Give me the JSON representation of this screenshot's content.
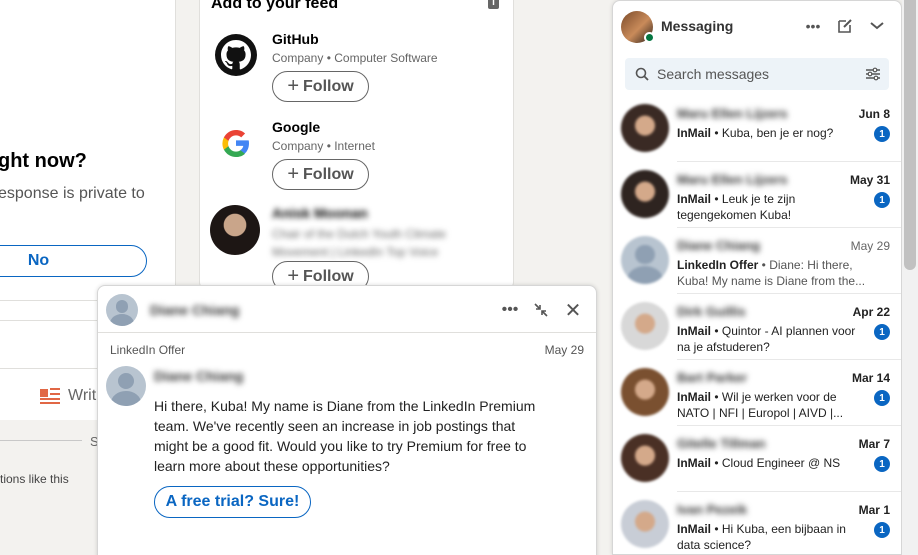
{
  "left": {
    "question": "ght now?",
    "sub": "esponse is private to",
    "no_button": "No",
    "write_label": "Writ",
    "s_label": "S",
    "options_text": "tions like this"
  },
  "feed": {
    "title": "Add to your feed",
    "items": [
      {
        "name": "GitHub",
        "meta": "Company • Computer Software",
        "follow": "Follow"
      },
      {
        "name": "Google",
        "meta": "Company • Internet",
        "follow": "Follow"
      },
      {
        "name": "Anisk Moonan",
        "meta": "Chair of the Dutch Youth Climate Movement | LinkedIn Top Voice",
        "follow": "Follow"
      }
    ]
  },
  "conversation": {
    "name": "Diane Chiang",
    "subject": "LinkedIn Offer",
    "date": "May 29",
    "sender": "Diane Chiang",
    "body": "Hi there, Kuba! My name is Diane from the LinkedIn Premium team. We've recently seen an increase in job postings that might be a good fit. Would you like to try Premium for free to learn more about these opportunities?",
    "cta": "A free trial? Sure!"
  },
  "messaging": {
    "title": "Messaging",
    "search_placeholder": "Search messages",
    "conversations": [
      {
        "name": "Maru Ellen Lijzers",
        "date": "Jun 8",
        "tag": "InMail",
        "preview": "Kuba, ben je er nog?",
        "badge": "1",
        "unread": true,
        "avatar": "#3a2a24"
      },
      {
        "name": "Maru Ellen Lijzers",
        "date": "May 31",
        "tag": "InMail",
        "preview": "Leuk je te zijn tegengekomen Kuba!",
        "badge": "1",
        "unread": true,
        "avatar": "#2e2420"
      },
      {
        "name": "Diane Chiang",
        "date": "May 29",
        "tag": "LinkedIn Offer",
        "preview": "Diane: Hi there, Kuba! My name is Diane from the...",
        "badge": "",
        "unread": false,
        "avatar": "#b8c4d0"
      },
      {
        "name": "Dirk Guillis",
        "date": "Apr 22",
        "tag": "InMail",
        "preview": "Quintor - AI plannen voor na je afstuderen?",
        "badge": "1",
        "unread": true,
        "avatar": "#d8d8d8"
      },
      {
        "name": "Bart Parker",
        "date": "Mar 14",
        "tag": "InMail",
        "preview": "Wil je werken voor de NATO | NFI | Europol | AIVD |...",
        "badge": "1",
        "unread": true,
        "avatar": "#7a5030"
      },
      {
        "name": "Gitelle Tillman",
        "date": "Mar 7",
        "tag": "InMail",
        "preview": "Cloud Engineer @ NS",
        "badge": "1",
        "unread": true,
        "avatar": "#4a3025"
      },
      {
        "name": "Ivan Pezeik",
        "date": "Mar 1",
        "tag": "InMail",
        "preview": "Hi Kuba, een bijbaan in data science?",
        "badge": "1",
        "unread": true,
        "avatar": "#c8cdd6"
      }
    ]
  }
}
